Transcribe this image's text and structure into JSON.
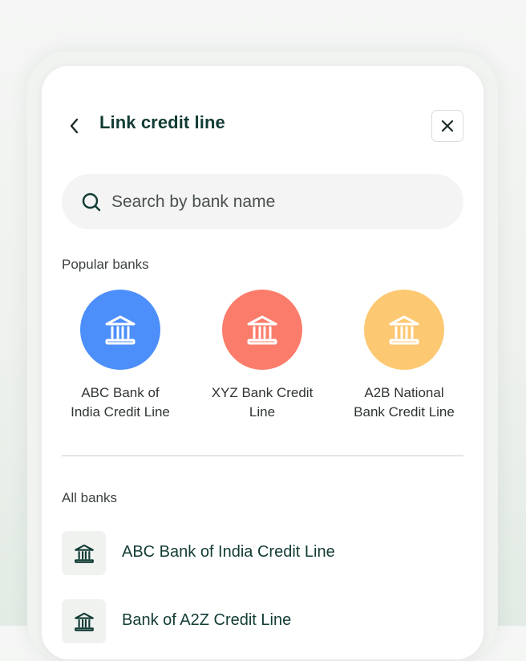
{
  "header": {
    "title": "Link credit line",
    "back_icon": "chevron-left-icon",
    "close_icon": "close-icon"
  },
  "search": {
    "placeholder": "Search by bank name",
    "value": "",
    "icon": "search-icon"
  },
  "popular": {
    "label": "Popular banks",
    "items": [
      {
        "name_line1": "ABC Bank of",
        "name_line2": "India Credit Line",
        "color": "#4d8ffa",
        "icon": "bank-icon"
      },
      {
        "name_line1": "XYZ Bank Credit",
        "name_line2": "Line",
        "color": "#fc7c6b",
        "icon": "bank-icon"
      },
      {
        "name_line1": "A2B National",
        "name_line2": "Bank Credit Line",
        "color": "#fdc872",
        "icon": "bank-icon"
      }
    ]
  },
  "all_banks": {
    "label": "All banks",
    "items": [
      {
        "name": "ABC Bank of India Credit Line",
        "icon": "bank-icon"
      },
      {
        "name": "Bank of A2Z Credit Line",
        "icon": "bank-icon"
      }
    ]
  },
  "colors": {
    "title": "#123c35",
    "icon_dark": "#123c35",
    "card": "#ffffff"
  }
}
